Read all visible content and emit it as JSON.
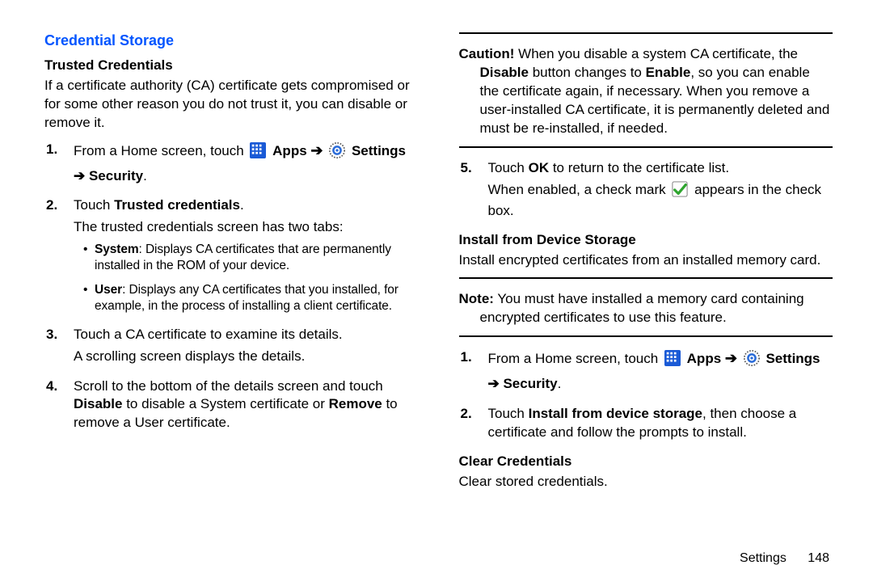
{
  "section_title": "Credential Storage",
  "left": {
    "sub1": "Trusted Credentials",
    "intro": "If a certificate authority (CA) certificate gets compromised or for some other reason you do not trust it, you can disable or remove it.",
    "step1_pre": "From a Home screen, touch ",
    "apps": " Apps ",
    "arrow": "➔",
    "settings": " Settings",
    "security_line": "➔ Security",
    "step2_a": "Touch ",
    "step2_b": "Trusted credentials",
    "step2_trail": "The trusted credentials screen has two tabs:",
    "bullet_sys_b": "System",
    "bullet_sys_t": ": Displays CA certificates that are permanently installed in the ROM of your device.",
    "bullet_usr_b": "User",
    "bullet_usr_t": ": Displays any CA certificates that you installed, for example, in the process of installing a client certificate.",
    "step3_a": "Touch a CA certificate to examine its details.",
    "step3_b": "A scrolling screen displays the details.",
    "step4_a": "Scroll to the bottom of the details screen and touch ",
    "step4_disable": "Disable",
    "step4_mid": " to disable a System certificate or ",
    "step4_remove": "Remove",
    "step4_end": " to remove a User certificate."
  },
  "right": {
    "caution_b": "Caution!",
    "caution_1": " When you disable a system CA certificate, the ",
    "caution_dis": "Disable",
    "caution_2": " button changes to ",
    "caution_en": "Enable",
    "caution_3": ", so you can enable the certificate again, if necessary. When you remove a user-installed CA certificate, it is permanently deleted and must be re-installed, if needed.",
    "step5_a": "Touch ",
    "step5_ok": "OK",
    "step5_b": " to return to the certificate list.",
    "step5_trail_a": "When enabled, a check mark ",
    "step5_trail_b": " appears in the check box.",
    "sub2": "Install from Device Storage",
    "install_intro": "Install encrypted certificates from an installed memory card.",
    "note_b": "Note:",
    "note_t": " You must have installed a memory card containing encrypted certificates to use this feature.",
    "r_step1_pre": "From a Home screen, touch ",
    "r_step2_a": "Touch ",
    "r_step2_b": "Install from device storage",
    "r_step2_c": ", then choose a certificate and follow the prompts to install.",
    "sub3": "Clear Credentials",
    "clear_text": "Clear stored credentials."
  },
  "footer": {
    "label": "Settings",
    "page": "148"
  }
}
